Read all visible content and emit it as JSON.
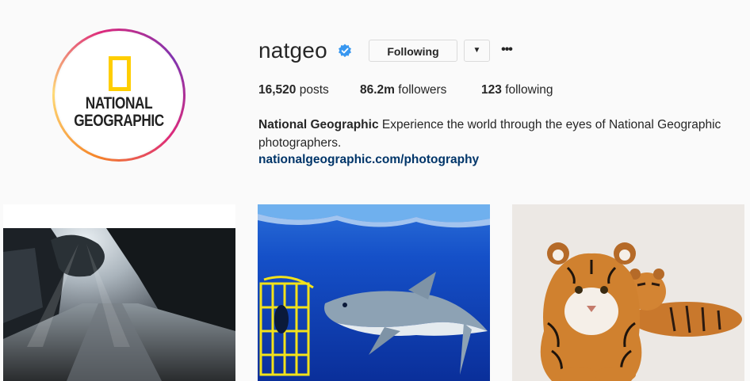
{
  "profile": {
    "username": "natgeo",
    "verified": true,
    "avatar": {
      "logo_line1": "NATIONAL",
      "logo_line2": "GEOGRAPHIC",
      "logo_color": "#ffce00"
    },
    "following_button": "Following",
    "dropdown_icon": "caret-down-icon",
    "more_icon": "ellipsis-icon"
  },
  "stats": {
    "posts_count": "16,520",
    "posts_label": "posts",
    "followers_count": "86.2m",
    "followers_label": "followers",
    "following_count": "123",
    "following_label": "following"
  },
  "bio": {
    "name": "National Geographic",
    "text": "Experience the world through the eyes of National Geographic photographers.",
    "link": "nationalgeographic.com/photography"
  },
  "posts": [
    {
      "subject": "misty forest road with sun rays"
    },
    {
      "subject": "oceanic whitetip shark beside diver cage"
    },
    {
      "subject": "tiger cubs on white background"
    }
  ],
  "colors": {
    "verified_blue": "#3897f0",
    "link_blue": "#003569",
    "border": "#dbdbdb"
  }
}
